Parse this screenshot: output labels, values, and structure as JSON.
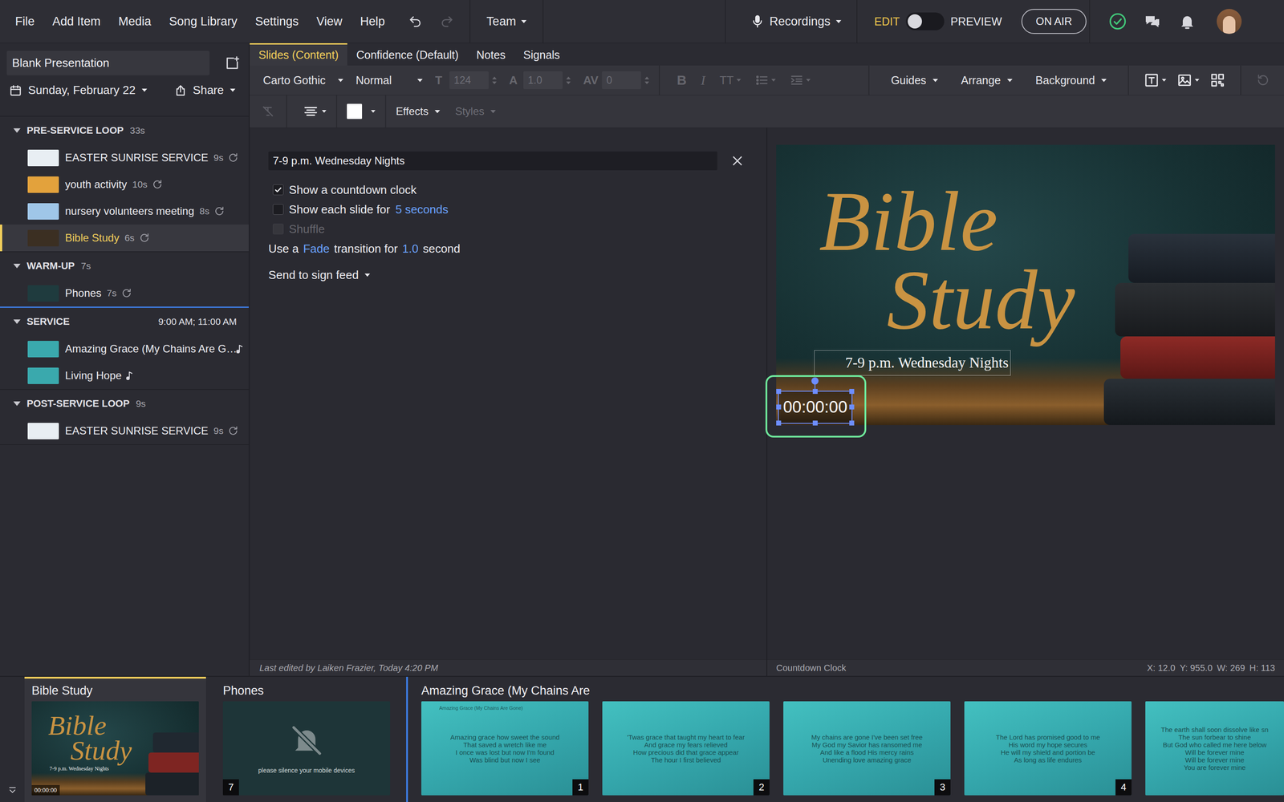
{
  "menubar": {
    "menus": [
      "File",
      "Add Item",
      "Media",
      "Song Library",
      "Settings",
      "View",
      "Help"
    ],
    "undo": {
      "disabled": false
    },
    "redo": {
      "disabled": true
    },
    "team": "Team",
    "recordings": "Recordings",
    "mode": {
      "edit": "EDIT",
      "preview": "PREVIEW",
      "preview_on": false
    },
    "on_air": "ON AIR",
    "status_ok": true
  },
  "sidebar": {
    "presentation": "Blank Presentation",
    "date": "Sunday, February 22",
    "share": "Share",
    "sections": [
      {
        "title": "PRE-SERVICE LOOP",
        "meta": "33s",
        "kind": "loop",
        "expanded": true,
        "marker": false,
        "items": [
          {
            "title": "EASTER SUNRISE SERVICE",
            "duration": "9s",
            "kind": "loop",
            "selected": false,
            "color": "#e8eef3"
          },
          {
            "title": "youth activity",
            "duration": "10s",
            "kind": "loop",
            "selected": false,
            "color": "#e3a23c"
          },
          {
            "title": "nursery volunteers meeting",
            "duration": "8s",
            "kind": "loop",
            "selected": false,
            "color": "#9fc6e8"
          },
          {
            "title": "Bible Study",
            "duration": "6s",
            "kind": "loop",
            "selected": true,
            "color": "#3b2f22"
          }
        ]
      },
      {
        "title": "WARM-UP",
        "meta": "7s",
        "kind": "loop",
        "expanded": true,
        "marker": false,
        "items": [
          {
            "title": "Phones",
            "duration": "7s",
            "kind": "loop",
            "selected": false,
            "color": "#1f3b3e"
          }
        ]
      },
      {
        "title": "SERVICE",
        "meta": "9:00 AM; 11:00 AM",
        "kind": "service",
        "expanded": true,
        "marker": true,
        "items": [
          {
            "title": "Amazing Grace (My Chains Are G…",
            "kind": "song",
            "selected": false,
            "color": "#3aa9ad"
          },
          {
            "title": "Living Hope",
            "kind": "song",
            "selected": false,
            "color": "#3aa9ad"
          }
        ]
      },
      {
        "title": "POST-SERVICE LOOP",
        "meta": "9s",
        "kind": "loop",
        "expanded": true,
        "marker": false,
        "items": [
          {
            "title": "EASTER SUNRISE SERVICE",
            "duration": "9s",
            "kind": "loop",
            "selected": false,
            "color": "#e8eef3"
          }
        ]
      }
    ]
  },
  "editor": {
    "tabs": [
      {
        "label": "Slides (Content)",
        "selected": true
      },
      {
        "label": "Confidence (Default)",
        "selected": false
      },
      {
        "label": "Notes",
        "selected": false
      },
      {
        "label": "Signals",
        "selected": false
      }
    ],
    "font": {
      "family": "Carto Gothic",
      "weight": "Normal"
    },
    "metrics": [
      {
        "icon": "T",
        "value": "124",
        "disabled": true
      },
      {
        "icon": "A",
        "value": "1.0",
        "disabled": true
      },
      {
        "icon": "AV",
        "value": "0",
        "disabled": true
      }
    ],
    "format": [
      {
        "kind": "bold",
        "label": "B",
        "disabled": true
      },
      {
        "kind": "italic",
        "label": "I",
        "disabled": true
      },
      {
        "kind": "case",
        "label": "TT",
        "disabled": true
      },
      {
        "kind": "list",
        "disabled": true
      },
      {
        "kind": "indent",
        "disabled": true
      }
    ],
    "tools": [
      "Guides",
      "Arrange",
      "Background"
    ],
    "reset": {
      "disabled": true
    },
    "clear": {
      "disabled": true
    },
    "color": "#ffffff",
    "effects": "Effects",
    "styles": {
      "label": "Styles",
      "disabled": true
    },
    "item_title": "7-9 p.m. Wednesday Nights",
    "options": [
      {
        "label": "Show a countdown clock",
        "checked": true,
        "disabled": false
      },
      {
        "label": "Show each slide for",
        "link": "5 seconds",
        "checked": false,
        "disabled": false
      },
      {
        "label": "Shuffle",
        "checked": false,
        "disabled": true
      }
    ],
    "transition": {
      "prefix": "Use a",
      "effect": "Fade",
      "middle": "transition for",
      "duration": "1.0",
      "suffix": "second"
    },
    "sign_feed": "Send to sign feed",
    "last_edited": "Last edited by Laiken Frazier, Today 4:20 PM"
  },
  "preview": {
    "title": "Bible Study",
    "subtitle": "7-9 p.m. Wednesday Nights",
    "countdown": "00:00:00",
    "countdown_selected": true,
    "highlighted": true,
    "selection_label": "Countdown Clock",
    "coords": [
      "X: 12.0",
      "Y: 955.0",
      "W: 269",
      "H: 113"
    ]
  },
  "filmstrip": {
    "groups": [
      {
        "title": "Bible Study",
        "selected": true,
        "marker_before": false,
        "slides": [
          {
            "kind": "countdown",
            "title": "Bible Study",
            "subtitle": "7-9 p.m. Wednesday Nights",
            "countdown": "00:00:00"
          }
        ]
      },
      {
        "title": "Phones",
        "selected": false,
        "marker_before": false,
        "slides": [
          {
            "kind": "notice",
            "text": "please silence your mobile devices",
            "number": "7"
          }
        ]
      },
      {
        "title": "Amazing Grace (My Chains Are",
        "selected": false,
        "marker_before": true,
        "slides": [
          {
            "kind": "lyrics",
            "heading": "Amazing Grace (My Chains Are Gone)",
            "lines": [
              "Amazing grace how sweet the sound",
              "That saved a wretch like me",
              "I once was lost but now I'm found",
              "Was blind but now I see"
            ],
            "number": "1"
          },
          {
            "kind": "lyrics",
            "lines": [
              "'Twas grace that taught my heart to fear",
              "And grace my fears relieved",
              "How precious did that grace appear",
              "The hour I first believed"
            ],
            "number": "2"
          },
          {
            "kind": "lyrics",
            "lines": [
              "My chains are gone I've been set free",
              "My God my Savior has ransomed me",
              "And like a flood His mercy rains",
              "Unending love amazing grace"
            ],
            "number": "3"
          },
          {
            "kind": "lyrics",
            "lines": [
              "The Lord has promised good to me",
              "His word my hope secures",
              "He will my shield and portion be",
              "As long as life endures"
            ],
            "number": "4"
          },
          {
            "kind": "lyrics",
            "lines": [
              "The earth shall soon dissolve like sn",
              "The sun forbear to shine",
              "But God who called me here below",
              "Will be forever mine",
              "Will be forever mine",
              "You are forever mine"
            ]
          }
        ]
      }
    ]
  }
}
